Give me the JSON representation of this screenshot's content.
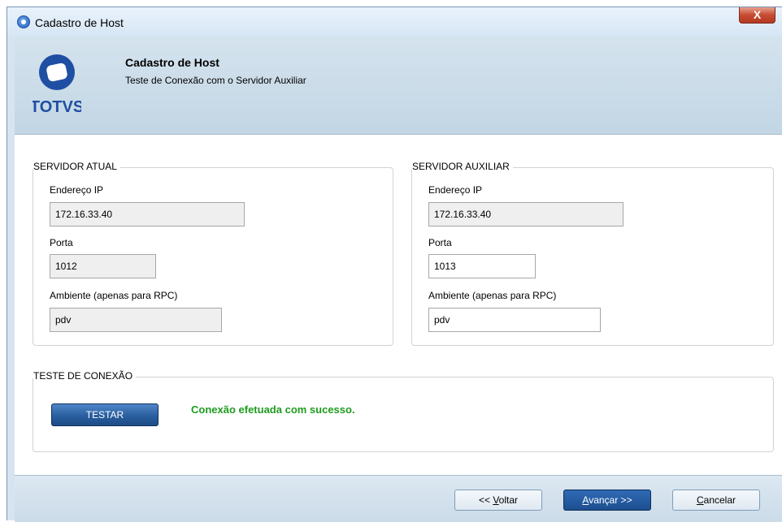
{
  "window": {
    "title": "Cadastro de Host",
    "close_label": "X"
  },
  "header": {
    "title": "Cadastro de Host",
    "subtitle": "Teste de Conexão com o Servidor Auxiliar",
    "logo_text": "TOTVS"
  },
  "servidor_atual": {
    "title": "SERVIDOR ATUAL",
    "ip_label": "Endereço IP",
    "ip_value": "172.16.33.40",
    "porta_label": "Porta",
    "porta_value": "1012",
    "ambiente_label": "Ambiente (apenas para RPC)",
    "ambiente_value": "pdv"
  },
  "servidor_auxiliar": {
    "title": "SERVIDOR AUXILIAR",
    "ip_label": "Endereço IP",
    "ip_value": "172.16.33.40",
    "porta_label": "Porta",
    "porta_value": "1013",
    "ambiente_label": "Ambiente (apenas para RPC)",
    "ambiente_value": "pdv"
  },
  "teste": {
    "title": "TESTE DE CONEXÃO",
    "button_label": "TESTAR",
    "status": "Conexão efetuada com sucesso."
  },
  "footer": {
    "voltar_prefix": "<< ",
    "voltar_key": "V",
    "voltar_rest": "oltar",
    "avancar_key": "A",
    "avancar_rest": "vançar >>",
    "cancelar_key": "C",
    "cancelar_rest": "ancelar"
  },
  "colors": {
    "status_success": "#1e9b1e",
    "header_bg": "#c9dbe8",
    "primary_button": "#1d4e8f",
    "logo_blue": "#1f4fa3"
  }
}
